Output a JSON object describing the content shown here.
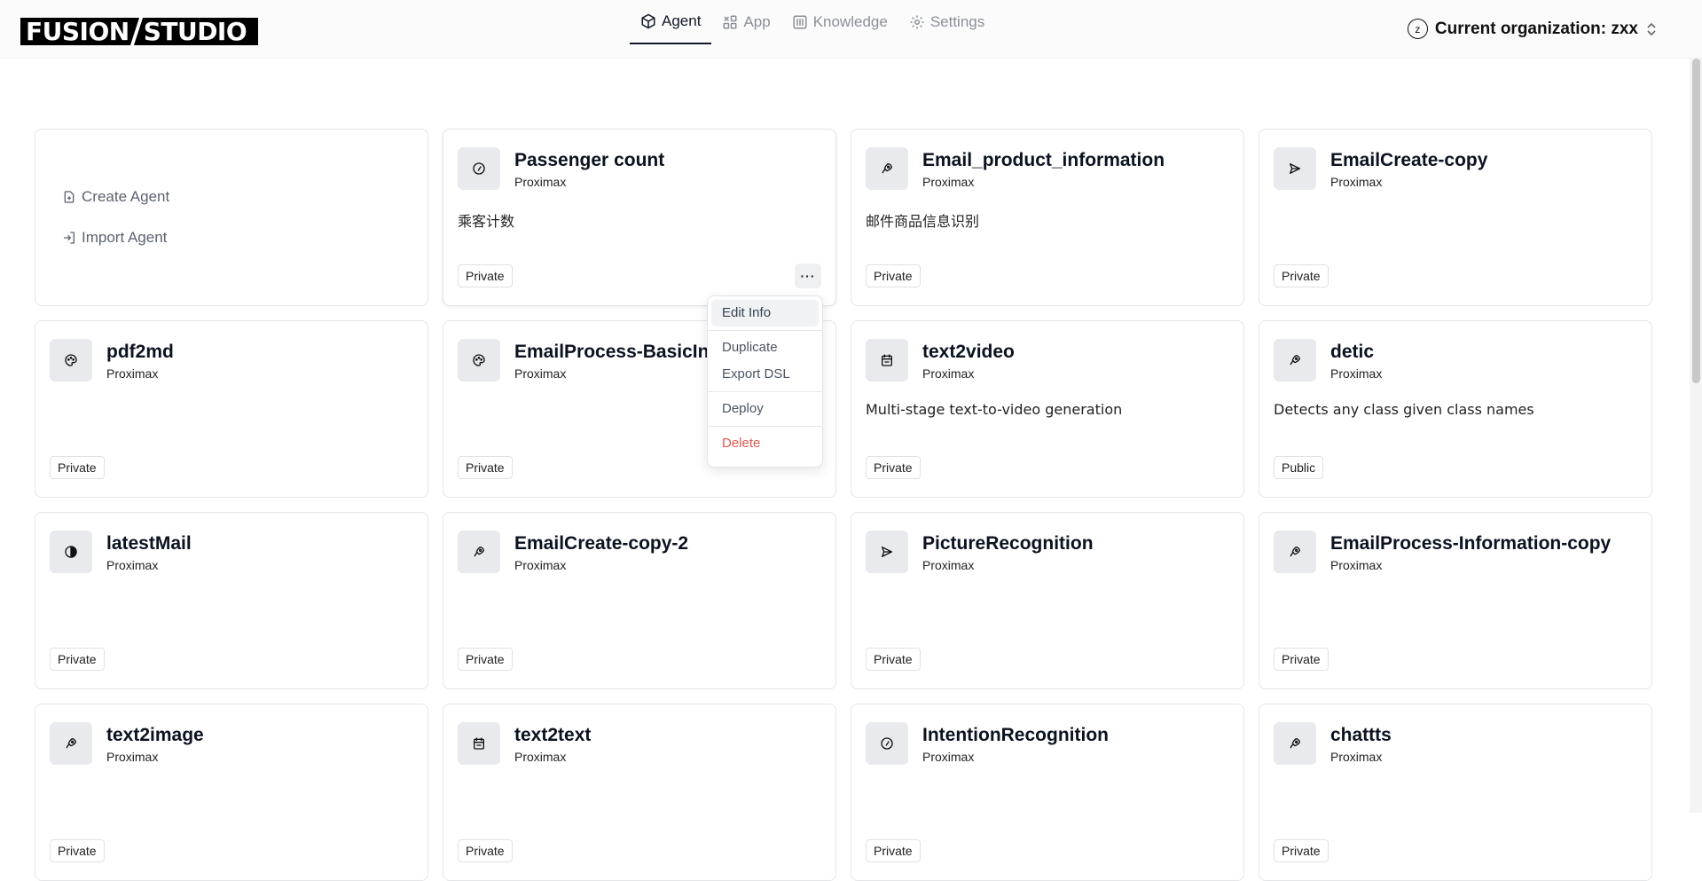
{
  "header": {
    "logo_left": "FUSION",
    "logo_right": "STUDIO",
    "nav": [
      {
        "label": "Agent",
        "icon": "box-icon",
        "active": true
      },
      {
        "label": "App",
        "icon": "app-grid-icon",
        "active": false
      },
      {
        "label": "Knowledge",
        "icon": "library-icon",
        "active": false
      },
      {
        "label": "Settings",
        "icon": "gear-icon",
        "active": false
      }
    ],
    "org_avatar": "z",
    "org_label": "Current organization: zxx"
  },
  "create_card": {
    "create_label": "Create Agent",
    "import_label": "Import Agent"
  },
  "agents": [
    {
      "title": "Passenger count",
      "owner": "Proximax",
      "desc": "乘客计数",
      "visibility": "Private",
      "icon": "compass-icon"
    },
    {
      "title": "Email_product_information",
      "owner": "Proximax",
      "desc": "邮件商品信息识别",
      "visibility": "Private",
      "icon": "rocket-icon"
    },
    {
      "title": "EmailCreate-copy",
      "owner": "Proximax",
      "desc": "",
      "visibility": "Private",
      "icon": "send-icon"
    },
    {
      "title": "pdf2md",
      "owner": "Proximax",
      "desc": "",
      "visibility": "Private",
      "icon": "palette-icon"
    },
    {
      "title": "EmailProcess-BasicInfo",
      "owner": "Proximax",
      "desc": "",
      "visibility": "Private",
      "icon": "palette-icon"
    },
    {
      "title": "text2video",
      "owner": "Proximax",
      "desc": "Multi-stage text-to-video generation",
      "visibility": "Private",
      "icon": "calendar-icon"
    },
    {
      "title": "detic",
      "owner": "Proximax",
      "desc": "Detects any class given class names",
      "visibility": "Public",
      "icon": "rocket-icon"
    },
    {
      "title": "latestMail",
      "owner": "Proximax",
      "desc": "",
      "visibility": "Private",
      "icon": "half-circle-icon"
    },
    {
      "title": "EmailCreate-copy-2",
      "owner": "Proximax",
      "desc": "",
      "visibility": "Private",
      "icon": "rocket-icon"
    },
    {
      "title": "PictureRecognition",
      "owner": "Proximax",
      "desc": "",
      "visibility": "Private",
      "icon": "send-icon"
    },
    {
      "title": "EmailProcess-Information-copy",
      "owner": "Proximax",
      "desc": "",
      "visibility": "Private",
      "icon": "rocket-icon"
    },
    {
      "title": "text2image",
      "owner": "Proximax",
      "desc": "",
      "visibility": "Private",
      "icon": "rocket-icon"
    },
    {
      "title": "text2text",
      "owner": "Proximax",
      "desc": "",
      "visibility": "Private",
      "icon": "calendar-icon"
    },
    {
      "title": "IntentionRecognition",
      "owner": "Proximax",
      "desc": "",
      "visibility": "Private",
      "icon": "compass-icon"
    },
    {
      "title": "chattts",
      "owner": "Proximax",
      "desc": "",
      "visibility": "Private",
      "icon": "rocket-icon"
    }
  ],
  "more_button": "···",
  "context_menu": {
    "items": [
      "Edit Info",
      "Duplicate",
      "Export DSL",
      "Deploy",
      "Delete"
    ]
  },
  "colors": {
    "accent": "#111827",
    "danger": "#e25a4f",
    "muted": "#8a8f98"
  }
}
